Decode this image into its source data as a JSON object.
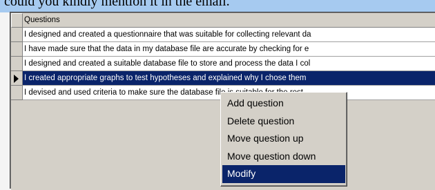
{
  "top_banner_text": "could you kindly mention it in the email.",
  "grid": {
    "header": "Questions",
    "rows": [
      {
        "text": "I designed and created a questionnaire that was suitable for collecting relevant da",
        "selected": false
      },
      {
        "text": "I have made sure that the data in my database file are accurate by checking for e",
        "selected": false
      },
      {
        "text": "I designed and created a suitable database file to store and process the data I col",
        "selected": false
      },
      {
        "text": "I created appropriate graphs to test hypotheses and explained why I chose them",
        "selected": true
      },
      {
        "text": "I devised and used criteria to make sure the database file is suitable for the rest",
        "selected": false
      }
    ]
  },
  "context_menu": {
    "items": [
      {
        "label": "Add question"
      },
      {
        "label": "Delete question"
      },
      {
        "label": "Move question up"
      },
      {
        "label": "Move question down"
      },
      {
        "label": "Modify",
        "highlighted": true
      }
    ]
  },
  "colors": {
    "selection": "#0a246a",
    "banner": "#a6caf0",
    "face": "#d4d0c8"
  }
}
